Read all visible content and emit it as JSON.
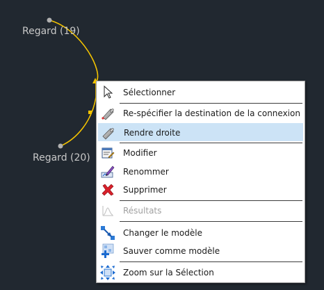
{
  "canvas": {
    "node_top_label": "Regard (19)",
    "node_bottom_label": "Regard (20)",
    "connection_color": "#f5c400"
  },
  "context_menu": {
    "items": [
      {
        "label": "Sélectionner",
        "icon": "cursor-arrow-icon"
      },
      {
        "label": "Re-spécifier la destination de la connexion",
        "icon": "pipe-respecify-icon"
      },
      {
        "label": "Rendre droite",
        "icon": "pipe-straight-icon"
      },
      {
        "label": "Modifier",
        "icon": "edit-form-icon"
      },
      {
        "label": "Renommer",
        "icon": "rename-pen-icon"
      },
      {
        "label": "Supprimer",
        "icon": "delete-x-icon"
      },
      {
        "label": "Résultats",
        "icon": "results-chart-icon"
      },
      {
        "label": "Changer le modèle",
        "icon": "change-template-icon"
      },
      {
        "label": "Sauver comme modèle",
        "icon": "save-template-icon"
      },
      {
        "label": "Zoom sur la Sélection",
        "icon": "zoom-selection-icon"
      }
    ],
    "highlighted": "Rendre droite",
    "disabled": "Résultats",
    "highlight_color": "#cce3f6"
  }
}
